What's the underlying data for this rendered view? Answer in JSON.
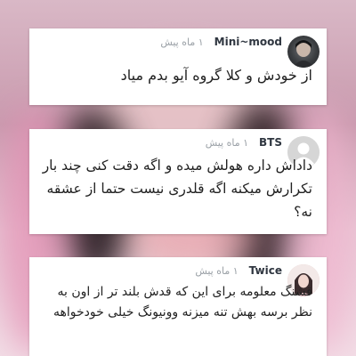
{
  "comments": [
    {
      "username": "Mini~mood",
      "time": "۱ ماه پیش",
      "text": "از خودش و کلا گروه آیو بدم میاد",
      "avatar_icon": "user-photo-avatar"
    },
    {
      "username": "BTS",
      "time": "۱ ماه پیش",
      "text": "داداش داره هولش میده و اگه دقت کنی چند بار تکرارش میکنه اگه قلدری نیست حتما از عشقه نه؟",
      "avatar_icon": "default-user-avatar"
    },
    {
      "username": "Twice",
      "time": "۱ ماه پیش",
      "text": "قشنگ معلومه برای این که قدش بلند تر از اون به نظر برسه بهش تنه میزنه وونیونگ خیلی خودخواهه",
      "avatar_icon": "user-photo-avatar"
    }
  ]
}
